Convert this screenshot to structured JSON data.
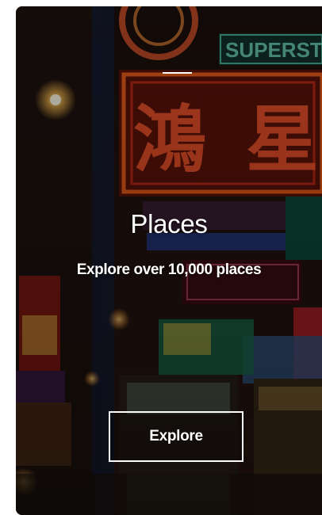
{
  "card": {
    "title": "Places",
    "subtitle": "Explore over 10,000 places",
    "button_label": "Explore",
    "background_image": "neon-street-signs-night-city"
  },
  "colors": {
    "text": "#ffffff",
    "button_border": "#ffffff"
  }
}
